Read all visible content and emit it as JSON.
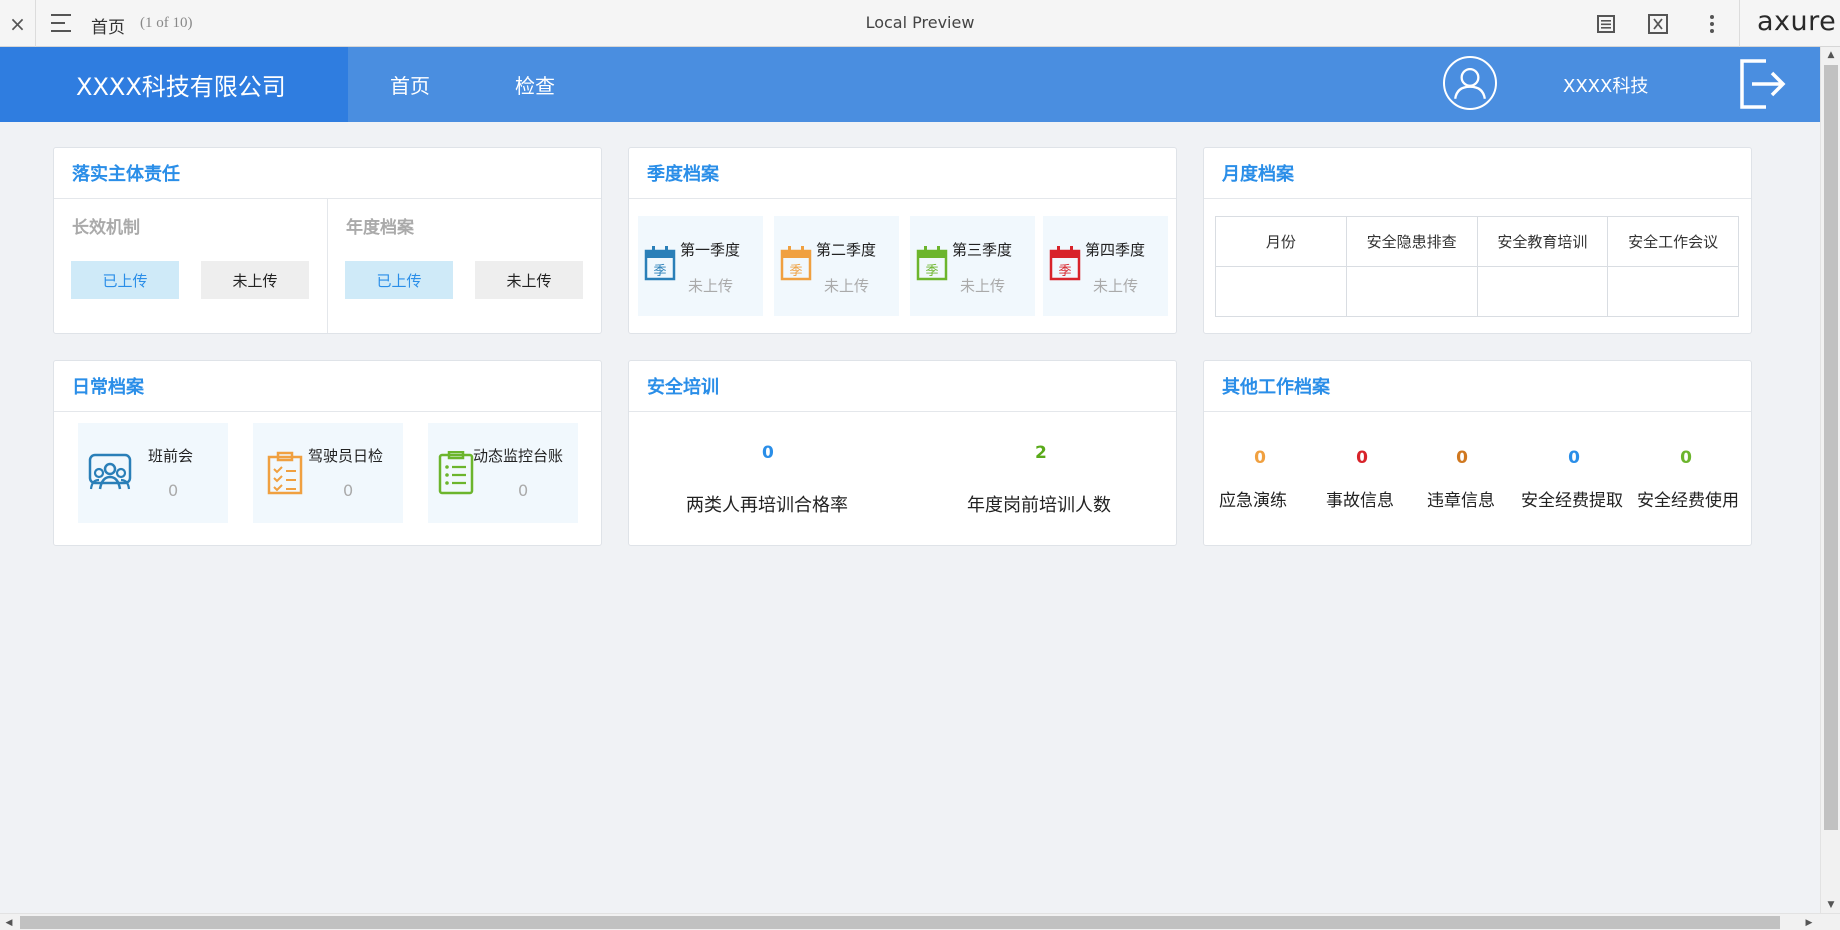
{
  "axure": {
    "close_glyph": "×",
    "page_name": "首页",
    "page_count": "(1 of 10)",
    "preview_title": "Local Preview",
    "logo": "axure"
  },
  "header": {
    "brand": "XXXX科技有限公司",
    "nav": [
      "首页",
      "检查"
    ],
    "username": "XXXX科技"
  },
  "responsibility": {
    "title": "落实主体责任",
    "sections": [
      {
        "title": "长效机制",
        "uploaded": "已上传",
        "not_uploaded": "未上传"
      },
      {
        "title": "年度档案",
        "uploaded": "已上传",
        "not_uploaded": "未上传"
      }
    ]
  },
  "quarterly": {
    "title": "季度档案",
    "icon_char": "季",
    "items": [
      {
        "name": "第一季度",
        "status": "未上传",
        "color": "#2a7fb8"
      },
      {
        "name": "第二季度",
        "status": "未上传",
        "color": "#f0a040"
      },
      {
        "name": "第三季度",
        "status": "未上传",
        "color": "#6cb52d"
      },
      {
        "name": "第四季度",
        "status": "未上传",
        "color": "#d8232a"
      }
    ]
  },
  "monthly": {
    "title": "月度档案",
    "columns": [
      "月份",
      "安全隐患排查",
      "安全教育培训",
      "安全工作会议"
    ]
  },
  "daily": {
    "title": "日常档案",
    "items": [
      {
        "name": "班前会",
        "count": "0",
        "color": "#2a7fb8",
        "icon": "people-icon"
      },
      {
        "name": "驾驶员日检",
        "count": "0",
        "color": "#f0a040",
        "icon": "clipboard-icon"
      },
      {
        "name": "动态监控台账",
        "count": "0",
        "color": "#6cb52d",
        "icon": "list-icon"
      }
    ]
  },
  "training": {
    "title": "安全培训",
    "items": [
      {
        "value": "0",
        "label": "两类人再培训合格率",
        "color": "#2a8ee8"
      },
      {
        "value": "2",
        "label": "年度岗前培训人数",
        "color": "#5aaa1a"
      }
    ]
  },
  "other": {
    "title": "其他工作档案",
    "items": [
      {
        "value": "0",
        "label": "应急演练",
        "color": "#f0a040"
      },
      {
        "value": "0",
        "label": "事故信息",
        "color": "#d8232a"
      },
      {
        "value": "0",
        "label": "违章信息",
        "color": "#d07820"
      },
      {
        "value": "0",
        "label": "安全经费提取",
        "color": "#2a8ee8"
      },
      {
        "value": "0",
        "label": "安全经费使用",
        "color": "#6cb52d"
      }
    ]
  }
}
